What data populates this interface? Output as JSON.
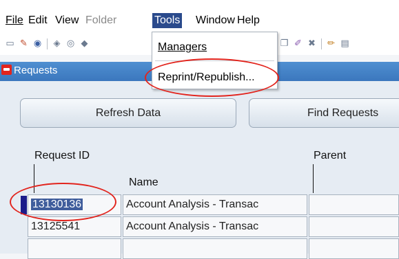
{
  "menu": {
    "file": "File",
    "edit": "Edit",
    "view": "View",
    "folder": "Folder",
    "tools": "Tools",
    "window": "Window",
    "help": "Help"
  },
  "tools_menu": {
    "managers": "Managers",
    "reprint": "Reprint/Republish..."
  },
  "window": {
    "title": "Requests"
  },
  "buttons": {
    "refresh": "Refresh Data",
    "find": "Find Requests"
  },
  "columns": {
    "request_id": "Request ID",
    "name": "Name",
    "parent": "Parent"
  },
  "rows": [
    {
      "id": "13130136",
      "name": "Account Analysis - Transac",
      "parent": ""
    },
    {
      "id": "13125541",
      "name": "Account Analysis - Transac",
      "parent": ""
    }
  ],
  "colors": {
    "active_menu": "#2a4a8c",
    "titlebar": "#3b77bd",
    "annotation": "#e2241d",
    "selection": "#3f5d9c"
  }
}
